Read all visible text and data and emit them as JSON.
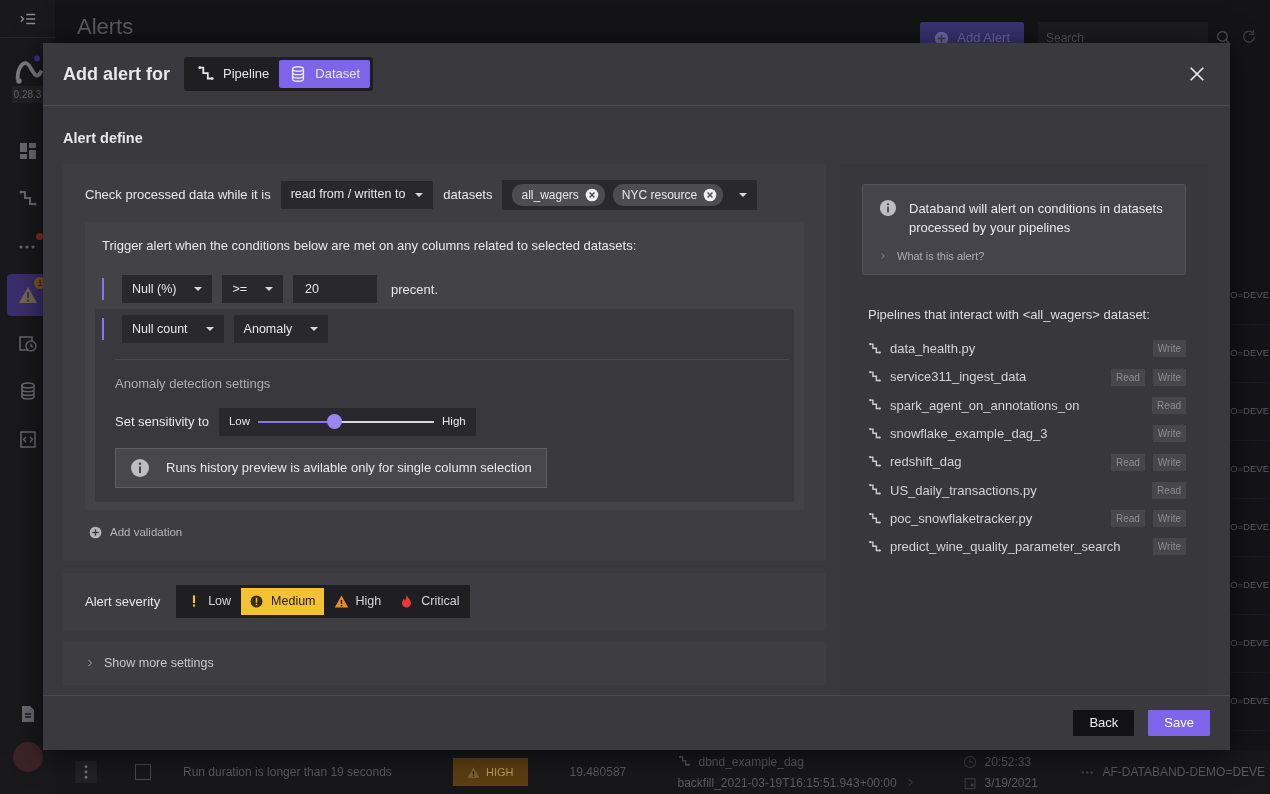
{
  "sidebar": {
    "version": "0.28.3",
    "items": [
      {
        "kind": "dashboard",
        "selected": false,
        "notification": false
      },
      {
        "kind": "pipeline",
        "selected": false,
        "notification": false
      },
      {
        "kind": "dots",
        "selected": false,
        "notification": true
      },
      {
        "kind": "alert",
        "selected": true,
        "notification": false,
        "badge": "1"
      },
      {
        "kind": "schedule",
        "selected": false,
        "notification": false
      },
      {
        "kind": "database",
        "selected": false,
        "notification": false
      },
      {
        "kind": "code",
        "selected": false,
        "notification": false
      }
    ],
    "bottom_items": [
      {
        "kind": "document"
      },
      {
        "kind": "avatar"
      }
    ]
  },
  "header": {
    "title": "Alerts",
    "add_button": "Add Alert",
    "search": {
      "placeholder": "Search"
    }
  },
  "table": {
    "rows": [
      {
        "kind": "partial",
        "column_last": "O=DEVE"
      },
      {
        "kind": "partial",
        "column_last": "O=DEVE"
      },
      {
        "kind": "partial",
        "column_last": "O=DEVE"
      },
      {
        "kind": "partial",
        "column_last": "O=DEVE"
      },
      {
        "kind": "partial",
        "column_last": "O=DEVE"
      },
      {
        "kind": "partial",
        "column_last": "O=DEVE"
      },
      {
        "kind": "partial",
        "column_last": "O=DEVE"
      },
      {
        "kind": "partial",
        "column_last": "O=DEVE"
      },
      {
        "kind": "full",
        "checked": false,
        "description": "Run duration is longer than 19 seconds",
        "severity": "HIGH",
        "value": "19.480587",
        "pipeline": "dbnd_example_dag",
        "run": "backfill_2021-03-19T16:15:51.943+00:00",
        "time": "20:52:33",
        "date": "3/19/2021",
        "source": "AF-DATABAND-DEMO=DEVE"
      }
    ]
  },
  "modal": {
    "title": "Add alert for",
    "targets": [
      {
        "kind": "pipeline",
        "label": "Pipeline",
        "selected": false
      },
      {
        "kind": "dataset",
        "label": "Dataset",
        "selected": true
      }
    ],
    "section_title": "Alert define",
    "scope": {
      "prefix": "Check processed data while it is",
      "mode": "read from / written to",
      "datasets_label": "datasets",
      "datasets": [
        "all_wagers",
        "NYC resource"
      ]
    },
    "conditions": {
      "intro": "Trigger alert when the conditions below are met on any columns related to selected datasets:",
      "rules": [
        {
          "kind": "threshold",
          "selected": false,
          "metric": "Null (%)",
          "operator": ">=",
          "value": "20",
          "suffix": "precent."
        },
        {
          "kind": "anomaly",
          "selected": true,
          "metric": "Null count",
          "operator": "Anomaly",
          "settings_title": "Anomaly detection settings",
          "sensitivity_label": "Set sensitivity to",
          "low": "Low",
          "high": "High",
          "level": 0.43,
          "note": "Runs history preview is avilable only for single column selection"
        }
      ],
      "add_label": "Add validation"
    },
    "severity": {
      "label": "Alert severity",
      "options": [
        {
          "kind": "low",
          "label": "Low",
          "selected": false
        },
        {
          "kind": "medium",
          "label": "Medium",
          "selected": true
        },
        {
          "kind": "high",
          "label": "High",
          "selected": false
        },
        {
          "kind": "critical",
          "label": "Critical",
          "selected": false
        }
      ]
    },
    "more_settings": {
      "label": "Show more settings",
      "expanded": false
    },
    "info": {
      "text": "Databand will alert on conditions in datasets processed by your pipelines",
      "help": "What is this alert?",
      "help_expanded": false
    },
    "pipelines": {
      "title": "Pipelines that interact with <all_wagers> dataset:",
      "items": [
        {
          "name": "data_health.py",
          "tags": [
            "Write"
          ]
        },
        {
          "name": "service311_ingest_data",
          "tags": [
            "Read",
            "Write"
          ]
        },
        {
          "name": "spark_agent_on_annotations_on",
          "tags": [
            "Read"
          ]
        },
        {
          "name": "snowflake_example_dag_3",
          "tags": [
            "Write"
          ]
        },
        {
          "name": "redshift_dag",
          "tags": [
            "Read",
            "Write"
          ]
        },
        {
          "name": "US_daily_transactions.py",
          "tags": [
            "Read"
          ]
        },
        {
          "name": "poc_snowflaketracker.py",
          "tags": [
            "Read",
            "Write"
          ]
        },
        {
          "name": "predict_wine_quality_parameter_search",
          "tags": [
            "Write"
          ]
        }
      ]
    },
    "buttons": [
      {
        "kind": "secondary",
        "label": "Back"
      },
      {
        "kind": "primary",
        "label": "Save"
      }
    ]
  }
}
